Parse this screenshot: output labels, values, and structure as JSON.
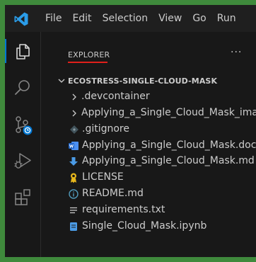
{
  "menu": {
    "items": [
      "File",
      "Edit",
      "Selection",
      "View",
      "Go",
      "Run"
    ]
  },
  "explorer": {
    "title": "EXPLORER",
    "more": "···",
    "root": "ECOSTRESS-SINGLE-CLOUD-MASK",
    "folders": [
      ".devcontainer",
      "Applying_a_Single_Cloud_Mask_ima..."
    ],
    "files": [
      {
        "name": ".gitignore",
        "icon": "gitignore-icon"
      },
      {
        "name": "Applying_a_Single_Cloud_Mask.docx",
        "icon": "word-doc-icon"
      },
      {
        "name": "Applying_a_Single_Cloud_Mask.md",
        "icon": "markdown-icon"
      },
      {
        "name": "LICENSE",
        "icon": "license-icon"
      },
      {
        "name": "README.md",
        "icon": "info-icon"
      },
      {
        "name": "requirements.txt",
        "icon": "text-file-icon"
      },
      {
        "name": "Single_Cloud_Mask.ipynb",
        "icon": "notebook-icon"
      }
    ]
  },
  "colors": {
    "accent": "#0078d4",
    "underline": "#e0201b",
    "background_green": "#3f8a3c"
  }
}
